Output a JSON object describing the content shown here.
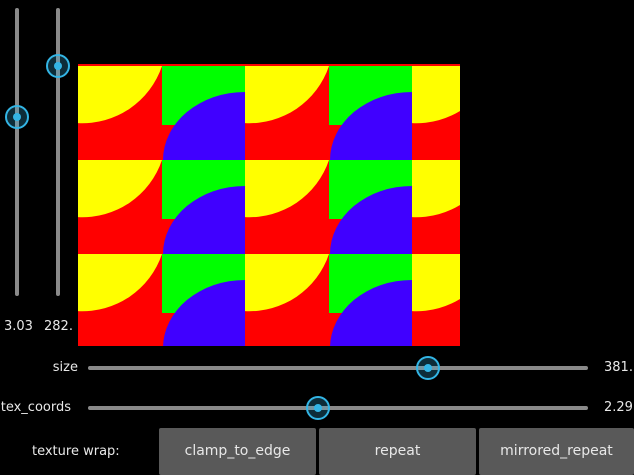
{
  "vertical_sliders": [
    {
      "name": "slider-a",
      "value_label": "3.03",
      "fraction": 0.62
    },
    {
      "name": "slider-b",
      "value_label": "282.",
      "fraction": 0.8
    }
  ],
  "horizontal_sliders": [
    {
      "label": "size",
      "value_label": "381.",
      "fraction": 0.68
    },
    {
      "label": "tex_coords",
      "value_label": "2.29",
      "fraction": 0.46
    }
  ],
  "texture_wrap": {
    "label": "texture wrap:",
    "options": [
      "clamp_to_edge",
      "repeat",
      "mirrored_repeat"
    ]
  },
  "colors": {
    "accent": "#33b5e5",
    "quad_background": "#ff0000",
    "quarter_circle_top": "#ffff00",
    "band_green": "#00ff00",
    "quarter_circle_bottom": "#4000ff"
  }
}
